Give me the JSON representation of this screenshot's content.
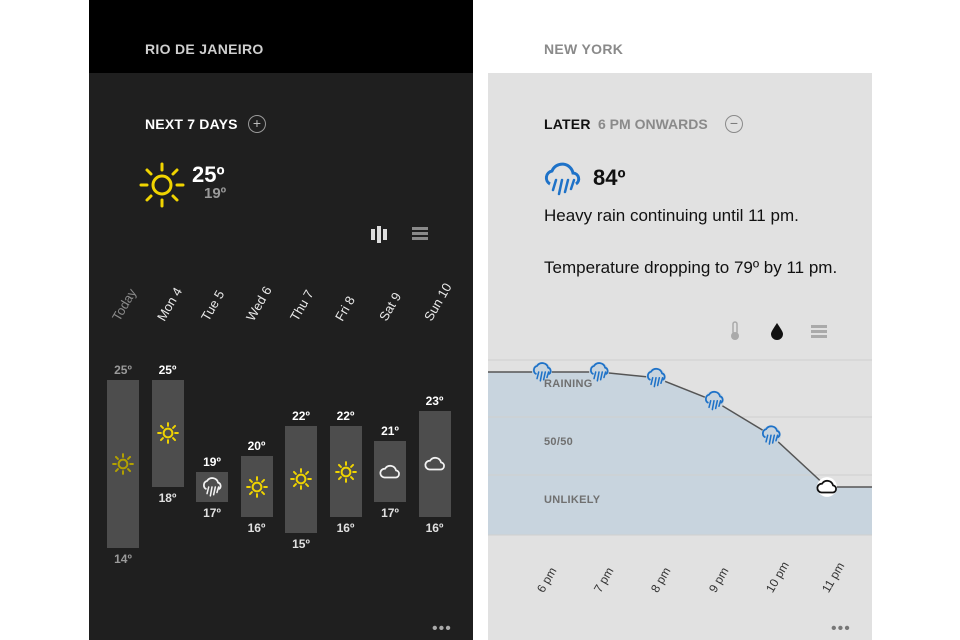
{
  "rio": {
    "city": "RIO DE JANEIRO",
    "section_label": "NEXT 7 DAYS",
    "expand_symbol": "+",
    "current_icon": "sun-icon",
    "current_high": "25º",
    "current_low": "19º",
    "view_buttons": [
      "bar-chart-view-icon",
      "list-view-icon"
    ],
    "days": [
      {
        "label": "Today",
        "high": "25º",
        "low": "14º",
        "icon": "sun-icon",
        "hi": 25,
        "lo": 14
      },
      {
        "label": "Mon 4",
        "high": "25º",
        "low": "18º",
        "icon": "sun-icon",
        "hi": 25,
        "lo": 18
      },
      {
        "label": "Tue 5",
        "high": "19º",
        "low": "17º",
        "icon": "rain-cloud-icon",
        "hi": 19,
        "lo": 17
      },
      {
        "label": "Wed 6",
        "high": "20º",
        "low": "16º",
        "icon": "sun-icon",
        "hi": 20,
        "lo": 16
      },
      {
        "label": "Thu 7",
        "high": "22º",
        "low": "15º",
        "icon": "sun-icon",
        "hi": 22,
        "lo": 15
      },
      {
        "label": "Fri 8",
        "high": "22º",
        "low": "16º",
        "icon": "sun-icon",
        "hi": 22,
        "lo": 16
      },
      {
        "label": "Sat 9",
        "high": "21º",
        "low": "17º",
        "icon": "cloud-icon",
        "hi": 21,
        "lo": 17
      },
      {
        "label": "Sun 10",
        "high": "23º",
        "low": "16º",
        "icon": "cloud-icon",
        "hi": 23,
        "lo": 16
      }
    ],
    "more_label": "•••"
  },
  "ny": {
    "city": "NEW YORK",
    "section_label": "LATER",
    "section_sub": "6 PM ONWARDS",
    "collapse_symbol": "−",
    "current_icon": "heavy-rain-icon",
    "current_temp": "84º",
    "desc1": "Heavy rain continuing until 11 pm.",
    "desc2": "Temperature dropping to 79º by 11 pm.",
    "view_buttons": [
      "thermometer-icon",
      "raindrop-icon",
      "list-view-icon"
    ],
    "chance_labels": [
      "RAINING",
      "50/50",
      "UNLIKELY"
    ],
    "hours": [
      {
        "label": "6 pm",
        "level": 1.0,
        "icon": "rain-cloud-icon"
      },
      {
        "label": "7 pm",
        "level": 1.0,
        "icon": "rain-cloud-icon"
      },
      {
        "label": "8 pm",
        "level": 0.95,
        "icon": "rain-cloud-icon"
      },
      {
        "label": "9 pm",
        "level": 0.75,
        "icon": "rain-cloud-icon"
      },
      {
        "label": "10 pm",
        "level": 0.45,
        "icon": "rain-cloud-icon"
      },
      {
        "label": "11 pm",
        "level": 0.0,
        "icon": "cloud-icon"
      }
    ],
    "more_label": "•••"
  },
  "colors": {
    "sun": "#f0d400",
    "rain_blue": "#1e72c8",
    "chart_fill": "#c8d4de"
  }
}
